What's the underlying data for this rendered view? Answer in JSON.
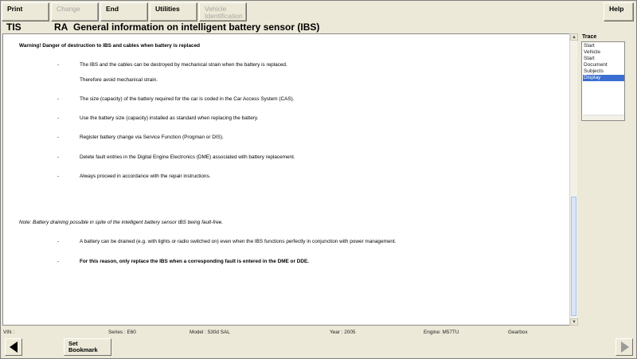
{
  "toolbar": {
    "print": "Print",
    "change": "Change",
    "end": "End",
    "utilities": "Utilities",
    "vehicle_line1": "Vehicle",
    "vehicle_line2": "Identification",
    "help": "Help"
  },
  "header": {
    "app": "TIS",
    "code": "RA",
    "title": "General information on intelligent battery sensor (IBS)"
  },
  "content": {
    "warning": "Warning! Danger of destruction to IBS and cables when battery is replaced",
    "items": [
      {
        "dash": "-",
        "text": "The IBS and the cables can be destroyed by mechanical strain when the battery is replaced."
      },
      {
        "dash": "",
        "text": "Therefore avoid mechanical strain."
      },
      {
        "dash": "-",
        "text": "The size (capacity) of the battery required for the car is coded in the Car Access System (CAS)."
      },
      {
        "dash": "-",
        "text": "Use the battery size (capacity) installed as standard when replacing the battery."
      },
      {
        "dash": "-",
        "text": "Register battery change via Service Function (Progman or DIS)."
      },
      {
        "dash": "-",
        "text": "Delete fault entries in the Digital Engine Electronics (DME) associated with battery replacement."
      },
      {
        "dash": "-",
        "text": "Always proceed in accordance with the repair instructions."
      }
    ],
    "note": "Note: Battery draining possible in spite of the intelligent battery sensor IBS being fault-free.",
    "note_items": [
      {
        "dash": "-",
        "text": "A battery can be drained (e.g. with lights or radio switched on) even when the IBS functions perfectly in conjunction with power management."
      },
      {
        "dash": "-",
        "text": "For this reason, only replace the IBS when a corresponding fault is entered in the DME or DDE."
      }
    ]
  },
  "trace": {
    "label": "Trace",
    "items": [
      "Start",
      "Vehicle",
      "Start",
      "Document",
      "Subjects",
      "Display"
    ],
    "selected": "Display"
  },
  "status": {
    "vin": "VIN :",
    "series": "Series : E60",
    "model": "Model : 530d SAL",
    "year": "Year : 2005",
    "engine": "Engine: M57TU",
    "gearbox": "Gearbox"
  },
  "nav": {
    "bookmark_line1": "Set",
    "bookmark_line2": "Bookmark"
  },
  "colors": {
    "background": "#ece9d8",
    "selection": "#3a6ed0",
    "scroll_thumb": "#d7e4fa"
  }
}
